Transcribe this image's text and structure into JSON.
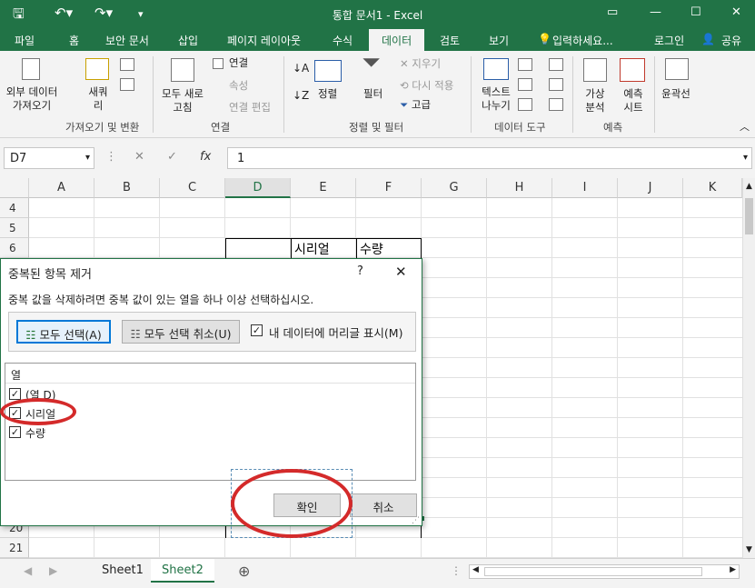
{
  "window": {
    "title": "통합 문서1 - Excel",
    "quick_access": [
      "save-icon",
      "undo-icon",
      "redo-icon",
      "customize-icon"
    ],
    "controls": [
      "ribbon-display-icon",
      "minimize-icon",
      "maximize-icon",
      "close-icon"
    ]
  },
  "tabs": {
    "file": "파일",
    "home": "홈",
    "security": "보안 문서",
    "insert": "삽입",
    "layout": "페이지 레이아웃",
    "formula": "수식",
    "data": "데이터",
    "review": "검토",
    "view": "보기",
    "tellme": "입력하세요...",
    "login": "로그인",
    "share": "공유"
  },
  "ribbon": {
    "ext_data": "외부 데이터\n가져오기",
    "new_query": "새쿼\n리",
    "refresh_all": "모두 새로\n고침",
    "connections": "연결",
    "properties": "속성",
    "edit_links": "연결 편집",
    "sort": "정렬",
    "filter": "필터",
    "clear": "지우기",
    "reapply": "다시 적용",
    "advanced": "고급",
    "text_to_columns": "텍스트\n나누기",
    "what_if": "가상\n분석",
    "forecast": "예측\n시트",
    "outline": "윤곽선",
    "groups": {
      "get_transform": "가져오기 및 변환",
      "connections": "연결",
      "sort_filter": "정렬 및 필터",
      "data_tools": "데이터 도구",
      "forecast": "예측"
    }
  },
  "formula_bar": {
    "name_box": "D7",
    "fx": "fx",
    "value": "1"
  },
  "columns": [
    "A",
    "B",
    "C",
    "D",
    "E",
    "F",
    "G",
    "H",
    "I",
    "J",
    "K"
  ],
  "rows": [
    "4",
    "5",
    "6",
    "20",
    "21"
  ],
  "cells": {
    "E6": "시리얼",
    "F6": "수량"
  },
  "sheets": [
    "Sheet1",
    "Sheet2"
  ],
  "dialog": {
    "title": "중복된 항목 제거",
    "help": "?",
    "instruction": "중복 값을 삭제하려면 중복 값이 있는 열을 하나 이상 선택하십시오.",
    "select_all": "모두 선택(A)",
    "unselect_all": "모두 선택 취소(U)",
    "has_headers": "내 데이터에 머리글 표시(M)",
    "column_header": "열",
    "columns": [
      {
        "label": "(열 D)",
        "checked": true
      },
      {
        "label": "시리얼",
        "checked": true
      },
      {
        "label": "수량",
        "checked": true
      }
    ],
    "ok": "확인",
    "cancel": "취소"
  },
  "colors": {
    "excel_green": "#217346",
    "annotation_red": "#d42a2a",
    "focus_blue": "#0078d7"
  }
}
